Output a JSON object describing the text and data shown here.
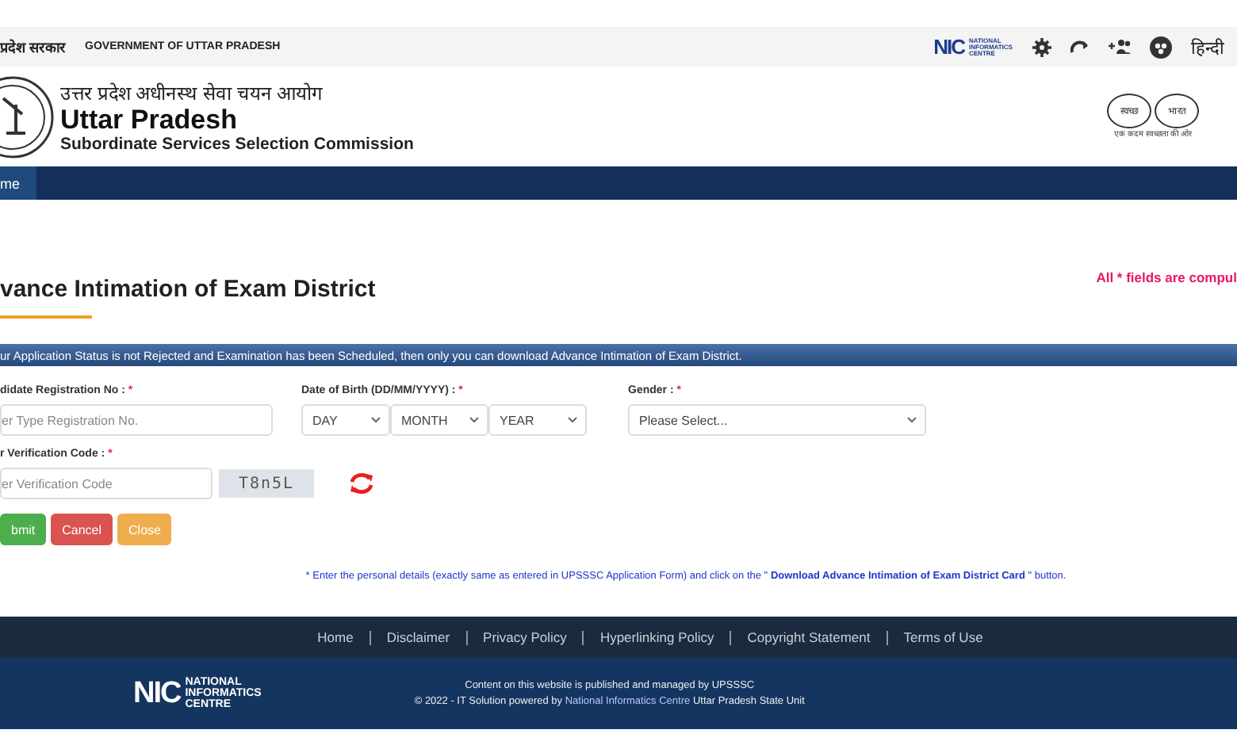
{
  "top_bar": {
    "hindi_label": "प्रदेश सरकार",
    "english_label": "GOVERNMENT OF UTTAR PRADESH",
    "nic_logo": {
      "main": "NIC",
      "sub": "NATIONAL INFORMATICS CENTRE"
    },
    "language": "हिन्दी"
  },
  "header": {
    "hindi_title": "उत्तर प्रदेश अधीनस्थ सेवा चयन आयोग",
    "title": "Uttar Pradesh",
    "subtitle": "Subordinate Services Selection Commission",
    "swachh": {
      "left": "स्वच्छ",
      "right": "भारत",
      "tagline": "एक कदम स्वच्छता की ओर"
    }
  },
  "nav": [
    {
      "label": "me",
      "selected": true
    }
  ],
  "page": {
    "title": "vance Intimation of Exam District",
    "required_note": "All * fields are compul",
    "banner": "ur Application Status is not Rejected and Examination has been Scheduled, then only you can download Advance Intimation of Exam District."
  },
  "form": {
    "registration": {
      "label": "didate Registration No : ",
      "required": "*",
      "placeholder": "er Type Registration No."
    },
    "dob": {
      "label": "Date of Birth (DD/MM/YYYY) : ",
      "required": "*",
      "selects": [
        "DAY",
        "MONTH",
        "YEAR"
      ]
    },
    "gender": {
      "label": "Gender : ",
      "required": "*",
      "value": "Please Select..."
    },
    "verification": {
      "label": "r Verification Code : ",
      "required": "*",
      "placeholder": "er Verification Code",
      "captcha": "T8n5L"
    },
    "buttons": [
      {
        "label": "bmit",
        "kind": "submit"
      },
      {
        "label": "Cancel",
        "kind": "cancel"
      },
      {
        "label": "Close",
        "kind": "close"
      }
    ]
  },
  "instruction": "* Enter the personal details (exactly same as entered in UPSSSC Application Form) and click on the \" **Download Advance Intimation of Exam District Card** \" button.",
  "footer": {
    "links": [
      "Home",
      "Disclaimer",
      "Privacy Policy",
      "Hyperlinking Policy",
      "Copyright Statement",
      "Terms of Use"
    ],
    "nic_logo": {
      "main": "NIC",
      "sub": "NATIONAL INFORMATICS CENTRE"
    },
    "managed": "Content on this website is published and managed by UPSSSC",
    "powered_prefix": "© 2022 - IT Solution powered by",
    "powered_link": "National Informatics Centre",
    "powered_suffix": "Uttar Pradesh State Unit"
  }
}
